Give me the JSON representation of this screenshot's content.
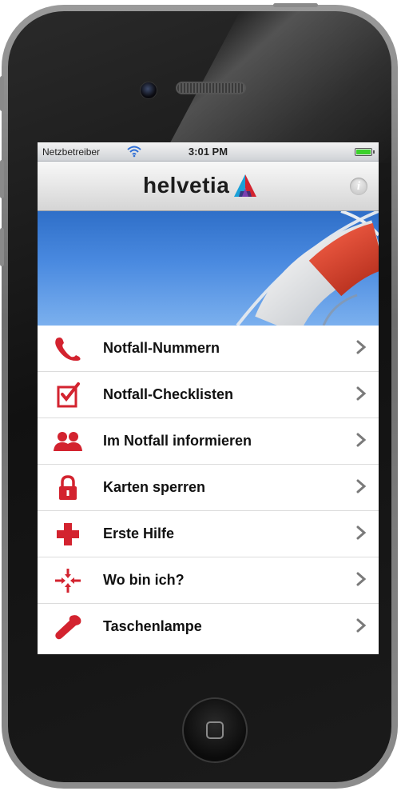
{
  "status_bar": {
    "carrier": "Netzbetreiber",
    "time": "3:01 PM",
    "wifi_icon": "wifi-icon",
    "battery_icon": "battery-icon",
    "battery_color": "#3bd12b"
  },
  "nav_bar": {
    "brand": "helvetia",
    "logo_icon": "helvetia-logo-icon",
    "info_icon": "info-icon",
    "info_label": "i"
  },
  "banner": {
    "image": "lifebuoy-image",
    "sky_color": "#4a8ae0",
    "ring_color": "#d8442e"
  },
  "menu": {
    "accent_color": "#d3232f",
    "items": [
      {
        "label": "Notfall-Nummern",
        "icon": "phone-icon"
      },
      {
        "label": "Notfall-Checklisten",
        "icon": "checklist-icon"
      },
      {
        "label": "Im Notfall informieren",
        "icon": "people-icon"
      },
      {
        "label": "Karten sperren",
        "icon": "lock-icon"
      },
      {
        "label": "Erste Hilfe",
        "icon": "cross-icon"
      },
      {
        "label": "Wo bin ich?",
        "icon": "location-arrows-icon"
      },
      {
        "label": "Taschenlampe",
        "icon": "flashlight-icon"
      }
    ],
    "chevron_icon": "chevron-right-icon"
  }
}
